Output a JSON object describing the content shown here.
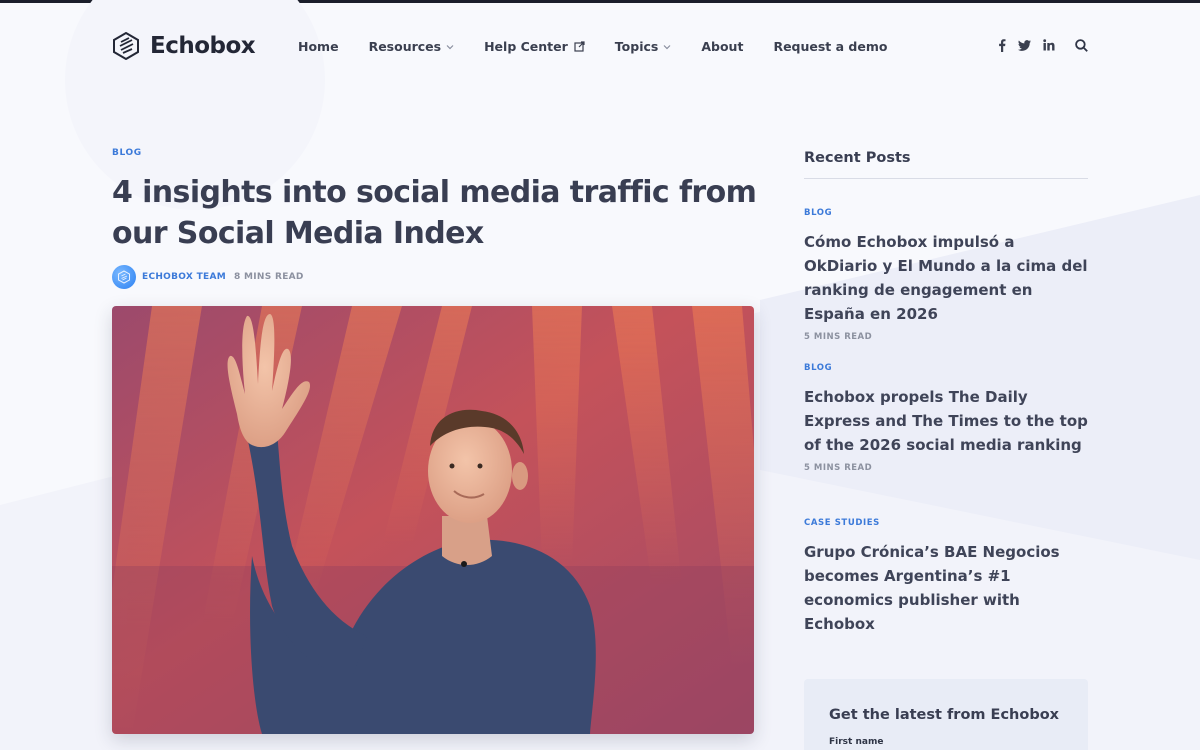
{
  "brand": {
    "name": "Echobox"
  },
  "nav": {
    "items": [
      {
        "label": "Home",
        "suffix": ""
      },
      {
        "label": "Resources",
        "suffix": "caret"
      },
      {
        "label": "Help Center",
        "suffix": "external"
      },
      {
        "label": "Topics",
        "suffix": "caret"
      },
      {
        "label": "About",
        "suffix": ""
      },
      {
        "label": "Request a demo",
        "suffix": ""
      }
    ],
    "social_icons": [
      "facebook-icon",
      "twitter-icon",
      "linkedin-icon",
      "search-icon"
    ]
  },
  "article": {
    "category": "BLOG",
    "title": "4 insights into social media traffic from our Social Media Index",
    "author": "ECHOBOX TEAM",
    "read_time": "8 MINS READ",
    "hero_image": "person-waving-on-stage"
  },
  "sidebar": {
    "heading": "Recent Posts",
    "posts": [
      {
        "category": "BLOG",
        "title": "Cómo Echobox impulsó a OkDiario y El Mundo a la cima del ranking de engagement en España en 2026",
        "read_time": "5 MINS READ"
      },
      {
        "category": "BLOG",
        "title": "Echobox propels The Daily Express and The Times to the top of the 2026 social media ranking",
        "read_time": "5 MINS READ"
      },
      {
        "category": "CASE STUDIES",
        "title": "Grupo Crónica’s BAE Negocios becomes Argentina’s #1 economics publisher with Echobox",
        "read_time": ""
      }
    ],
    "newsletter": {
      "title": "Get the latest from Echobox",
      "first_name_label": "First name"
    }
  },
  "colors": {
    "accent": "#3c7ad9",
    "text": "#393e52",
    "background": "#f8f9fd"
  }
}
